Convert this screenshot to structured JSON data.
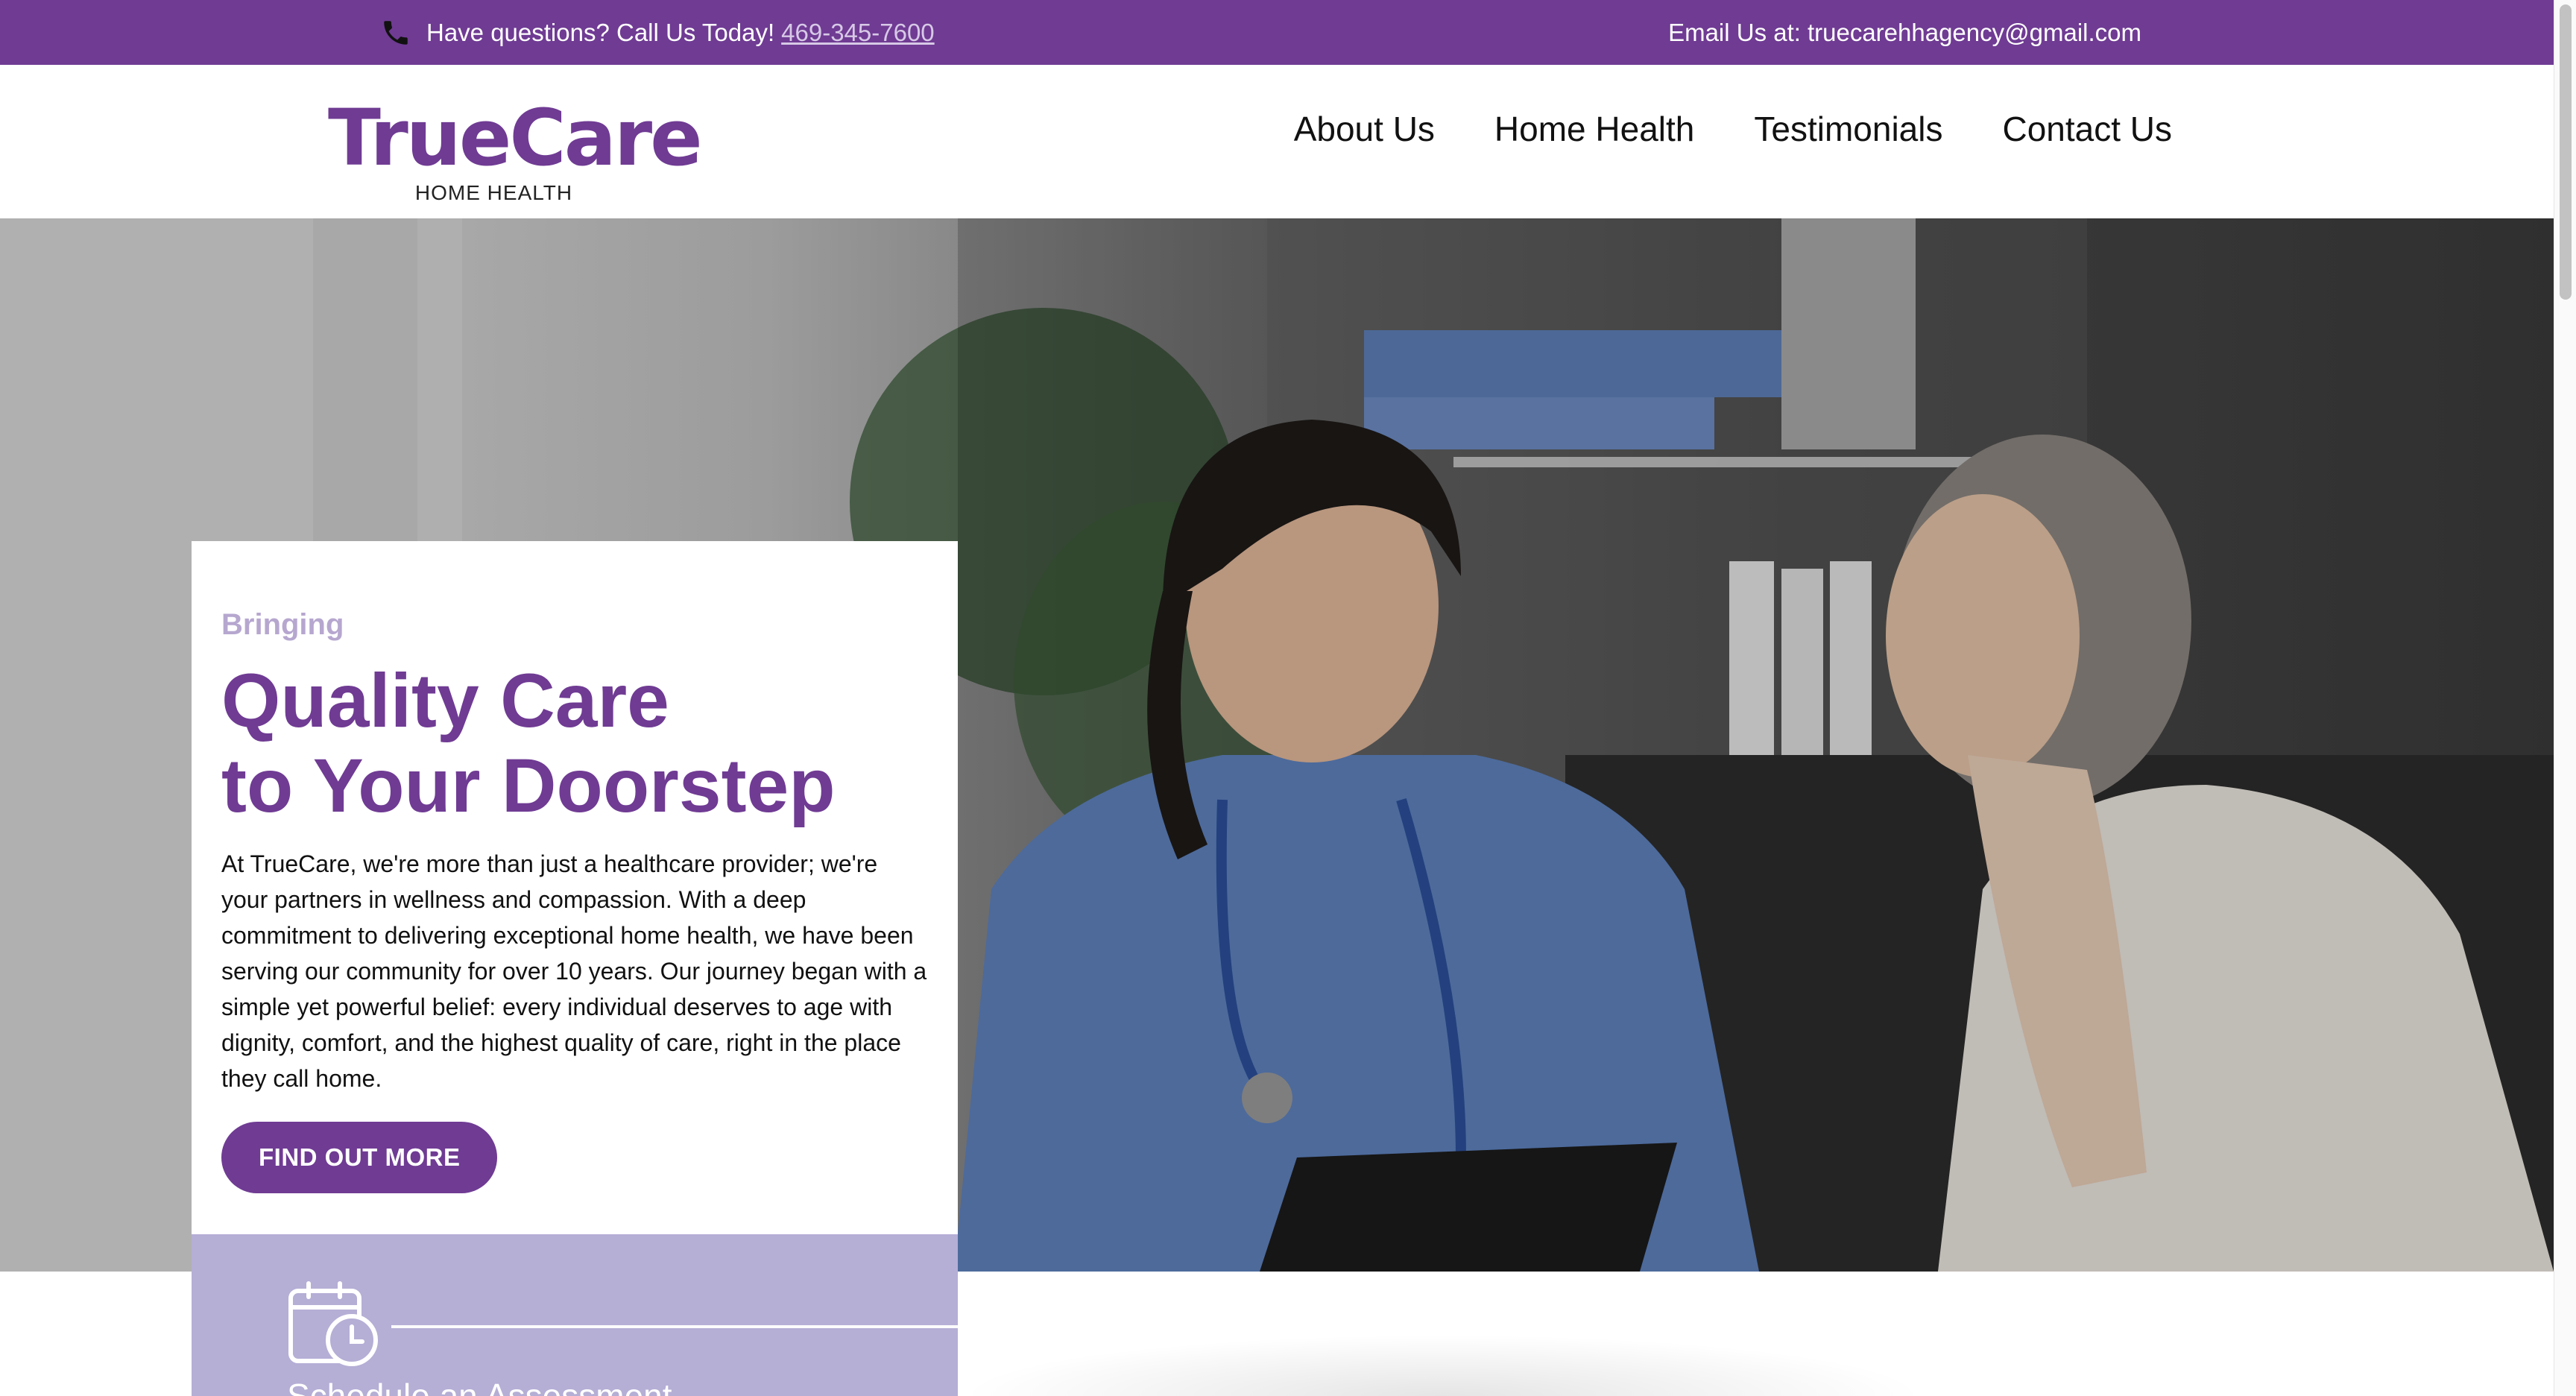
{
  "topbar": {
    "phone_prompt": "Have questions? Call Us Today!",
    "phone_number": "469-345-7600",
    "email_prompt": "Email Us at:",
    "email_address": "truecarehhagency@gmail.com",
    "background_color": "#6f3b93",
    "phone_icon": "phone-icon"
  },
  "logo": {
    "wordmark": "TrueCare",
    "subtitle": "HOME HEALTH",
    "color": "#6f3b93"
  },
  "nav": {
    "items": [
      {
        "label": "About Us"
      },
      {
        "label": "Home Health"
      },
      {
        "label": "Testimonials"
      },
      {
        "label": "Contact Us"
      }
    ]
  },
  "hero": {
    "eyebrow": "Bringing",
    "headline_line1": "Quality Care",
    "headline_line2": "to Your Doorstep",
    "body": "At TrueCare, we're more than just a healthcare provider; we're your partners in wellness and compassion. With a deep commitment to delivering exceptional home health, we have been serving our community for over 10 years. Our journey began with a simple yet powerful belief: every individual deserves to age with dignity, comfort, and the highest quality of care, right in the place they call home.",
    "cta_label": "FIND OUT MORE",
    "accent_color": "#6f3b93",
    "eyebrow_color": "#b6a7cf"
  },
  "schedule": {
    "label": "Schedule an Assessment",
    "icon": "calendar-clock-icon",
    "background_color": "#b5aed5"
  }
}
